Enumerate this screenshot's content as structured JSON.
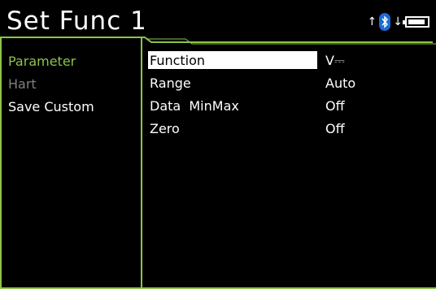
{
  "header": {
    "title": "Set Func 1",
    "status_icons": [
      "upload-arrow-icon",
      "bluetooth-icon",
      "download-arrow-icon",
      "battery-icon"
    ],
    "battery_level": 0.9
  },
  "menu": {
    "items": [
      {
        "label": "Parameter",
        "color": "#8bc34a"
      },
      {
        "label": "Hart",
        "color": "#808080"
      },
      {
        "label": "Save Custom",
        "color": "#ffffff"
      }
    ]
  },
  "params": {
    "rows": [
      {
        "name": "Function",
        "value": "V⎓"
      },
      {
        "name": "Range",
        "value": "Auto"
      },
      {
        "name": "Data  MinMax",
        "value": "Off"
      },
      {
        "name": "Zero",
        "value": "Off"
      }
    ]
  },
  "colors": {
    "accent": "#8bc34a",
    "background": "#000000",
    "bluetooth": "#1a6cd6"
  }
}
